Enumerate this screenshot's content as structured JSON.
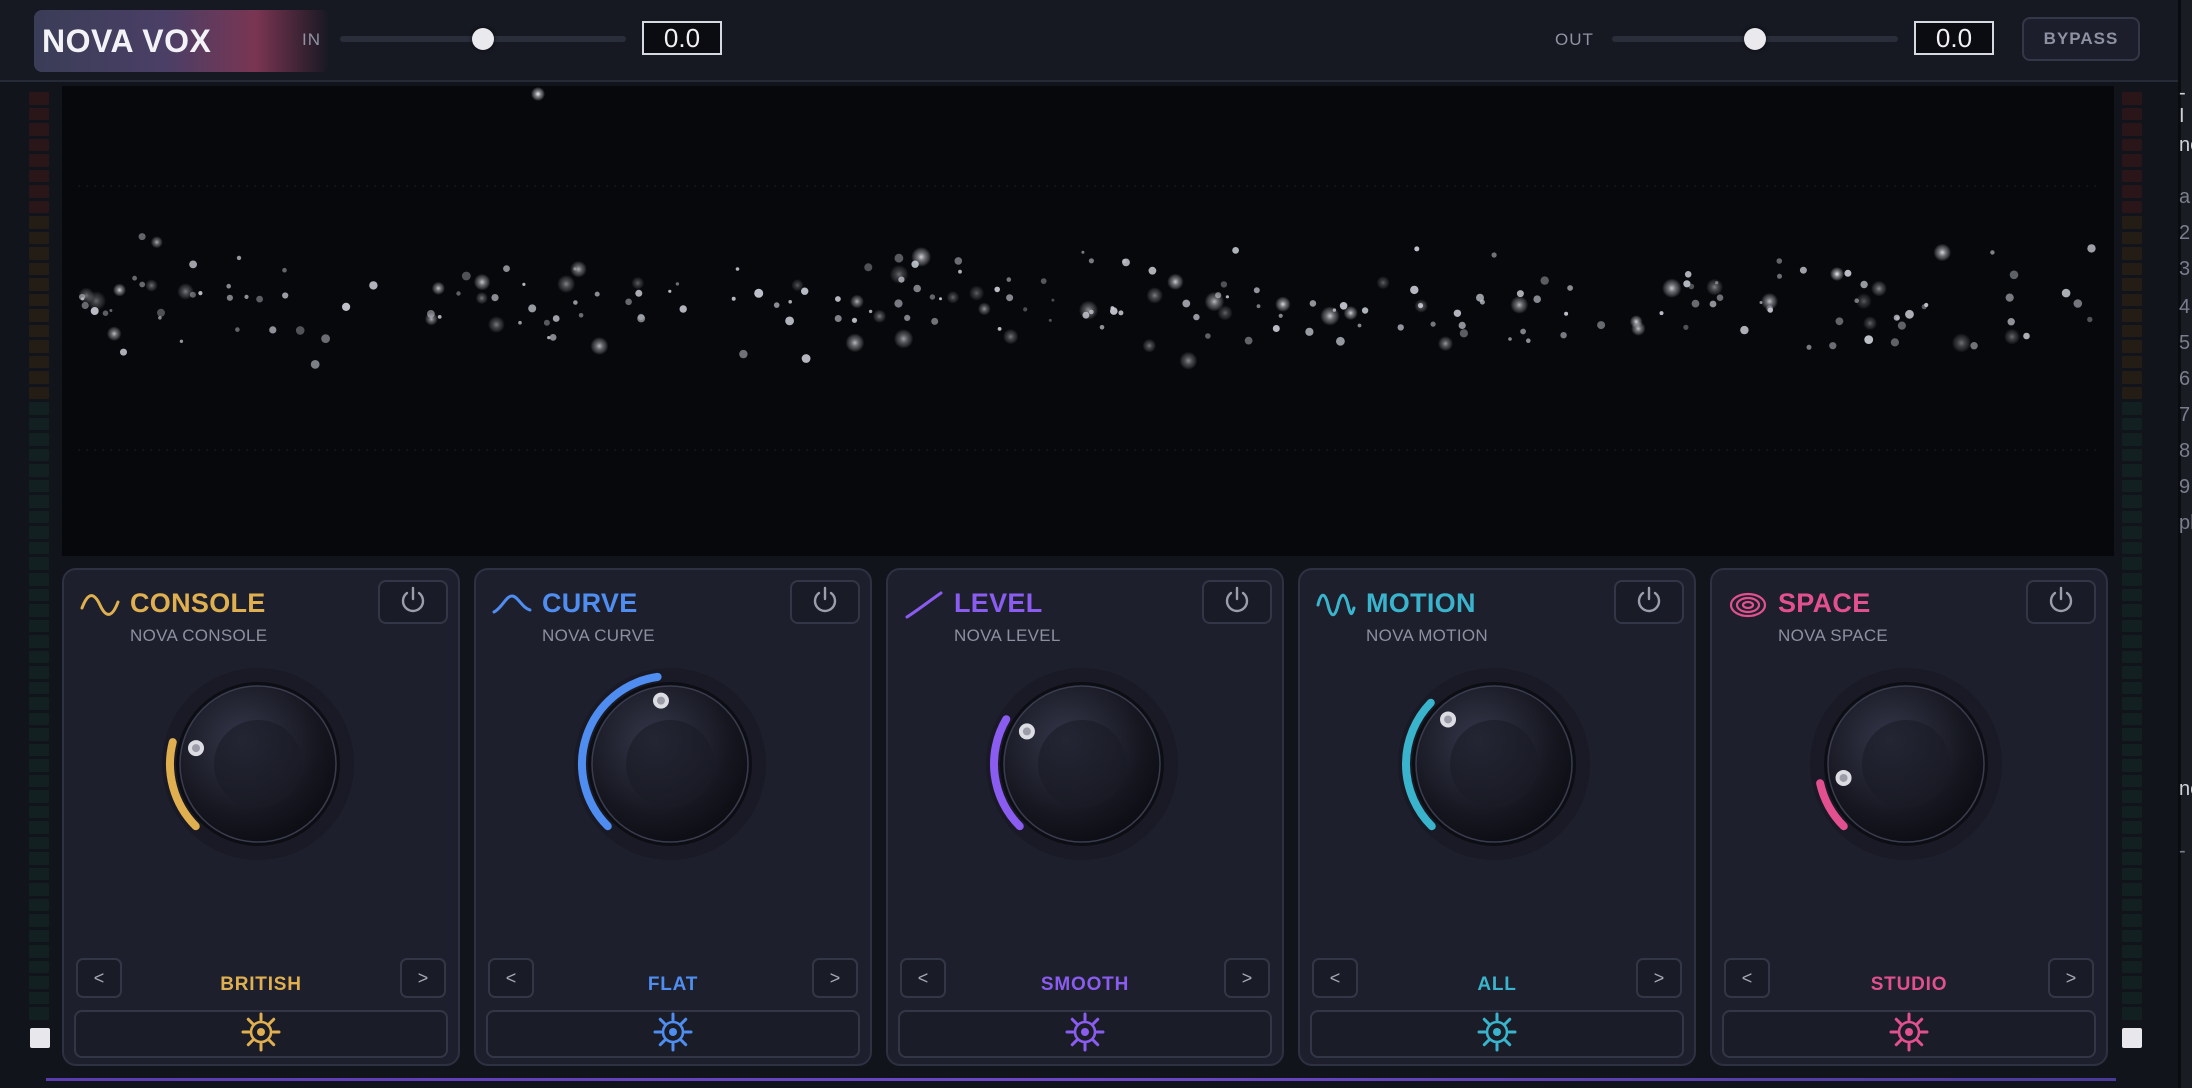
{
  "app": {
    "logo_text": "NOVA VOX",
    "input": {
      "label": "IN",
      "value": "0.0",
      "slider_level": 0.5
    },
    "output": {
      "label": "OUT",
      "value": "0.0",
      "slider_level": 0.5
    },
    "bypass_label": "BYPASS"
  },
  "modules": [
    {
      "title": "CONSOLE",
      "subtitle": "NOVA CONSOLE",
      "preset": "BRITISH",
      "color": "#e0b050",
      "icon": "sine-wave-icon",
      "knob_level": 0.22,
      "prev": "<",
      "next": ">"
    },
    {
      "title": "CURVE",
      "subtitle": "NOVA CURVE",
      "preset": "FLAT",
      "color": "#4f8ef0",
      "icon": "curve-icon",
      "knob_level": 0.47,
      "prev": "<",
      "next": ">"
    },
    {
      "title": "LEVEL",
      "subtitle": "NOVA LEVEL",
      "preset": "SMOOTH",
      "color": "#8a5cf0",
      "icon": "slope-line-icon",
      "knob_level": 0.28,
      "prev": "<",
      "next": ">"
    },
    {
      "title": "MOTION",
      "subtitle": "NOVA MOTION",
      "preset": "ALL",
      "color": "#3ab4cc",
      "icon": "double-wave-icon",
      "knob_level": 0.33,
      "prev": "<",
      "next": ">"
    },
    {
      "title": "SPACE",
      "subtitle": "NOVA SPACE",
      "preset": "STUDIO",
      "color": "#e2508f",
      "icon": "concentric-rings-icon",
      "knob_level": 0.12,
      "prev": "<",
      "next": ">"
    }
  ],
  "edge_text": [
    "- I",
    "ne",
    "a",
    "2",
    "3",
    "4",
    "5",
    "6",
    "7",
    "8",
    "9",
    "ph",
    "ne",
    "-"
  ]
}
